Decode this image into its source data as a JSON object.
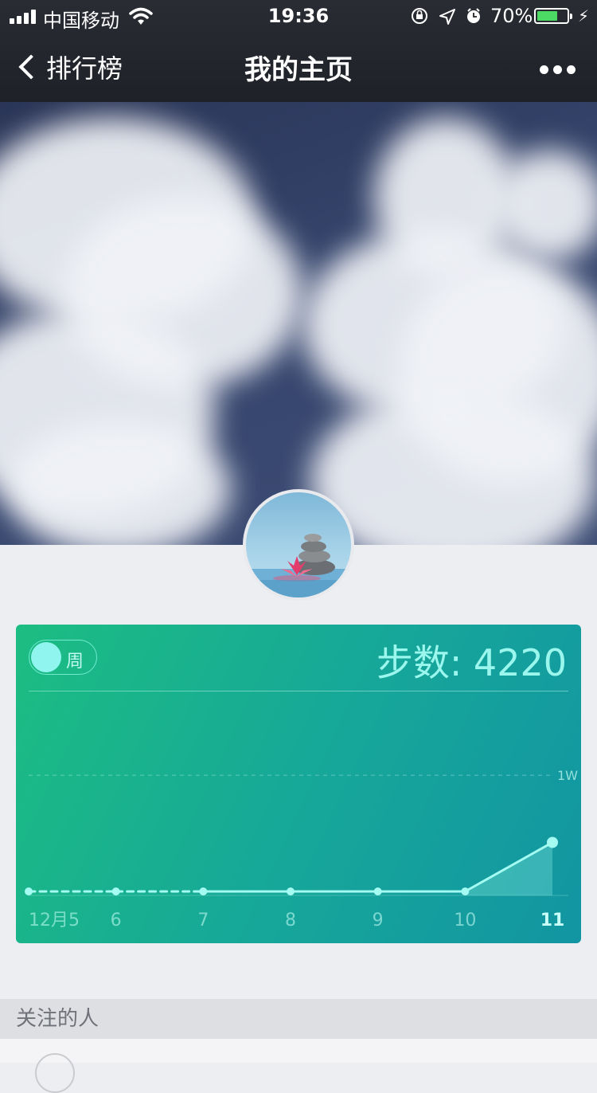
{
  "status_bar": {
    "carrier": "中国移动",
    "time": "19:36",
    "battery": "70%",
    "battery_level": 0.7
  },
  "nav": {
    "back_label": "排行榜",
    "title": "我的主页"
  },
  "card": {
    "toggle_label": "周",
    "steps_text": "步数: 4220"
  },
  "chart_data": {
    "type": "line",
    "categories": [
      "12月5",
      "6",
      "7",
      "8",
      "9",
      "10",
      "11"
    ],
    "values": [
      0,
      0,
      0,
      0,
      0,
      0,
      4220
    ],
    "reference_line": {
      "value": 10000,
      "label": "1W"
    },
    "highlight_category": "11",
    "ylim": [
      0,
      12000
    ]
  },
  "follow": {
    "header": "关注的人"
  },
  "colors": {
    "card_start": "#1cbd82",
    "card_end": "#1295a2",
    "accent": "#8ff5ee"
  }
}
